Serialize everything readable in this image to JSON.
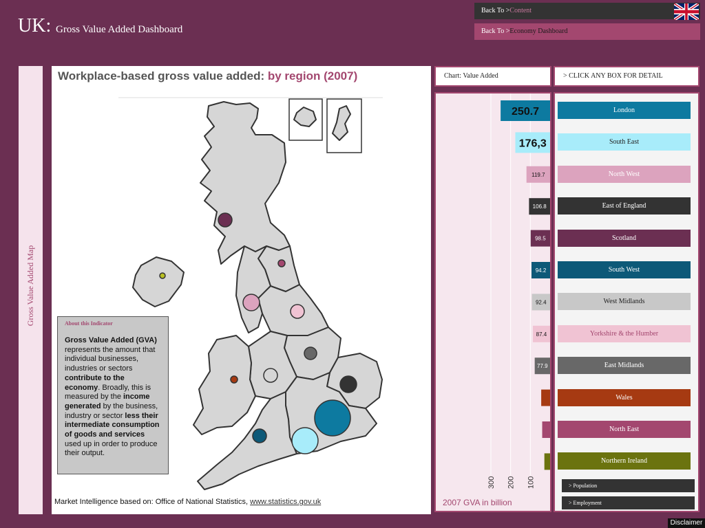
{
  "header": {
    "title_main": "UK:",
    "title_sub": "Gross Value Added Dashboard",
    "back_content": {
      "prefix": "Back  To  >",
      "target": "Content"
    },
    "back_economy": {
      "prefix": "Back  To  >",
      "target": "Economy Dashboard"
    }
  },
  "sidebar": {
    "label": "Gross Value Added  Map"
  },
  "map": {
    "title_plain": "Workplace-based gross value added:",
    "title_accent": "by region (2007)",
    "source_text": "Market Intelligence based on: Office of National Statistics,",
    "source_link": "www.statistics.gov.uk"
  },
  "about": {
    "title": "About this Indicator",
    "segments": [
      {
        "text": "Gross Value Added (GVA)",
        "bold": true
      },
      {
        "text": " represents the amount that individual businesses, industries or sectors ",
        "bold": false
      },
      {
        "text": "contribute to the economy",
        "bold": true
      },
      {
        "text": ". Broadly, this is measured by the ",
        "bold": false
      },
      {
        "text": "income generated",
        "bold": true
      },
      {
        "text": " by the business, industry or sector ",
        "bold": false
      },
      {
        "text": "less their intermediate consumption of goods and services",
        "bold": true
      },
      {
        "text": " used up in order to produce their output.",
        "bold": false
      }
    ]
  },
  "chart_panel": {
    "header": "Chart: Value Added",
    "axis_caption": "2007 GVA in billion"
  },
  "click_panel": {
    "header": "> CLICK ANY BOX FOR DETAIL"
  },
  "chart_data": {
    "type": "bar",
    "orientation": "horizontal",
    "xlabel": "2007 GVA in billion",
    "xlim": [
      0,
      300
    ],
    "x_ticks": [
      "100",
      "200",
      "300"
    ],
    "categories": [
      "London",
      "South East",
      "North West",
      "East of England",
      "Scotland",
      "South West",
      "West Midlands",
      "Yorkshire & the Humber",
      "East Midlands",
      "Wales",
      "North East",
      "Northern Ireland"
    ],
    "values": [
      250.7,
      176.3,
      119.7,
      106.8,
      98.5,
      94.2,
      92.4,
      87.4,
      77.9,
      45,
      40,
      29
    ],
    "value_labels": [
      "250.7",
      "176,3",
      "119.7",
      "106.8",
      "98.5",
      "94.2",
      "92.4",
      "87.4",
      "77.9",
      "",
      "",
      ""
    ],
    "colors": [
      "#0d7aa0",
      "#a8ecfa",
      "#dca3be",
      "#333333",
      "#6b2f52",
      "#0d5978",
      "#c8c8c8",
      "#f0c3d3",
      "#686868",
      "#a63a12",
      "#a3476f",
      "#6b730f"
    ]
  },
  "regions": [
    {
      "label": "London",
      "bg": "#0d7aa0",
      "fg": "#ffffff"
    },
    {
      "label": "South East",
      "bg": "#a8ecfa",
      "fg": "#222222"
    },
    {
      "label": "North West",
      "bg": "#dca3be",
      "fg": "#ffffff"
    },
    {
      "label": "East of England",
      "bg": "#333333",
      "fg": "#ffffff"
    },
    {
      "label": "Scotland",
      "bg": "#6b2f52",
      "fg": "#ffffff"
    },
    {
      "label": "South West",
      "bg": "#0d5978",
      "fg": "#ffffff"
    },
    {
      "label": "West Midlands",
      "bg": "#c8c8c8",
      "fg": "#222222"
    },
    {
      "label": "Yorkshire & the Humber",
      "bg": "#f0c3d3",
      "fg": "#a3476f"
    },
    {
      "label": "East Midlands",
      "bg": "#686868",
      "fg": "#ffffff"
    },
    {
      "label": "Wales",
      "bg": "#a63a12",
      "fg": "#ffffff"
    },
    {
      "label": "North East",
      "bg": "#a3476f",
      "fg": "#ffffff"
    },
    {
      "label": "Northern Ireland",
      "bg": "#6b730f",
      "fg": "#ffffff"
    }
  ],
  "links": [
    {
      "label": "> Population"
    },
    {
      "label": "> Employment"
    }
  ],
  "footer": {
    "disclaimer": "Disclaimer"
  }
}
